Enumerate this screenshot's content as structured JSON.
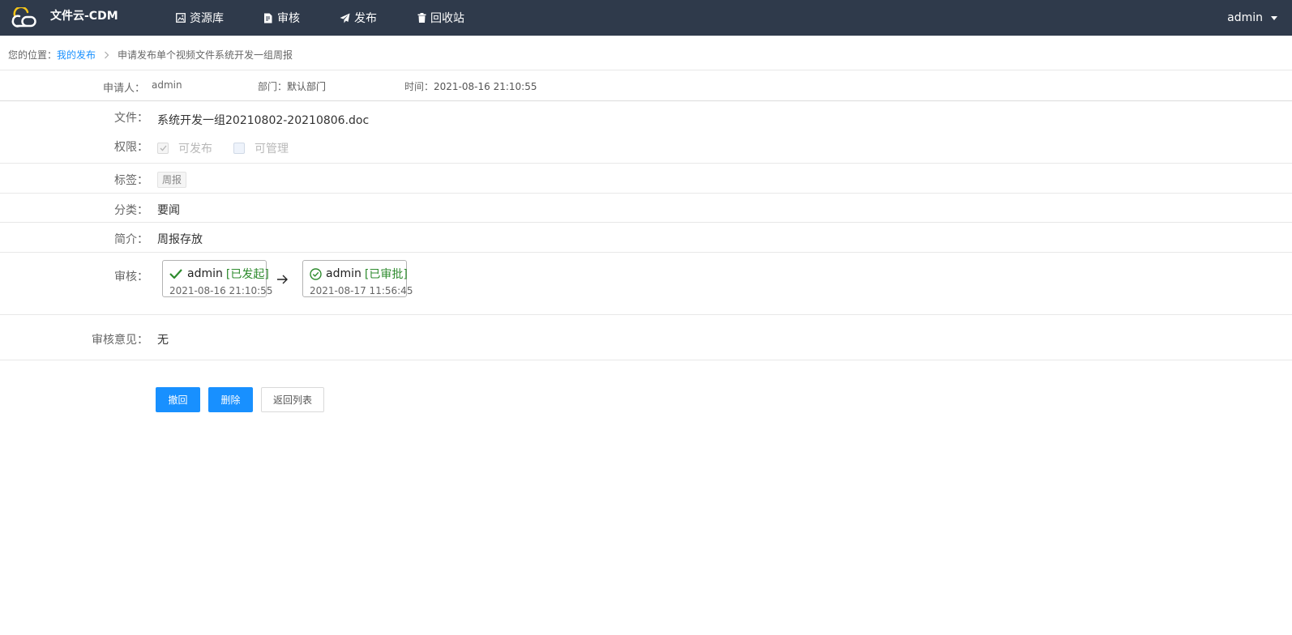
{
  "app": {
    "name": "文件云-CDM"
  },
  "nav": [
    {
      "label": "资源库",
      "icon": "image-icon"
    },
    {
      "label": "审核",
      "icon": "file-edit-icon"
    },
    {
      "label": "发布",
      "icon": "send-icon"
    },
    {
      "label": "回收站",
      "icon": "trash-icon"
    }
  ],
  "user": {
    "name": "admin"
  },
  "breadcrumb": {
    "prefix": "您的位置：",
    "link": "我的发布",
    "current": "申请发布单个视频文件系统开发一组周报"
  },
  "meta": {
    "applicant_label": "申请人：",
    "applicant": "admin",
    "dept_label": "部门：",
    "dept": "默认部门",
    "time_label": "时间：",
    "time": "2021-08-16 21:10:55"
  },
  "form": {
    "file_label": "文件：",
    "file": "系统开发一组20210802-20210806.doc",
    "perm_label": "权限：",
    "perm_publish": "可发布",
    "perm_publish_checked": true,
    "perm_manage": "可管理",
    "perm_manage_checked": false,
    "tag_label": "标签：",
    "tag": "周报",
    "category_label": "分类：",
    "category": "要闻",
    "intro_label": "简介：",
    "intro": "周报存放",
    "review_label": "审核：",
    "opinion_label": "审核意见：",
    "opinion": "无"
  },
  "review_flow": [
    {
      "user": "admin",
      "status": "[已发起]",
      "time": "2021-08-16 21:10:55",
      "icon": "check-icon"
    },
    {
      "user": "admin",
      "status": "[已审批]",
      "time": "2021-08-17 11:56:45",
      "icon": "check-circle-icon"
    }
  ],
  "buttons": {
    "withdraw": "撤回",
    "delete": "删除",
    "back": "返回列表"
  },
  "colors": {
    "topbar": "#2f3a4b",
    "primary": "#1890ff",
    "status_green": "#2e8b2e",
    "logo_yellow": "#f5c518"
  }
}
